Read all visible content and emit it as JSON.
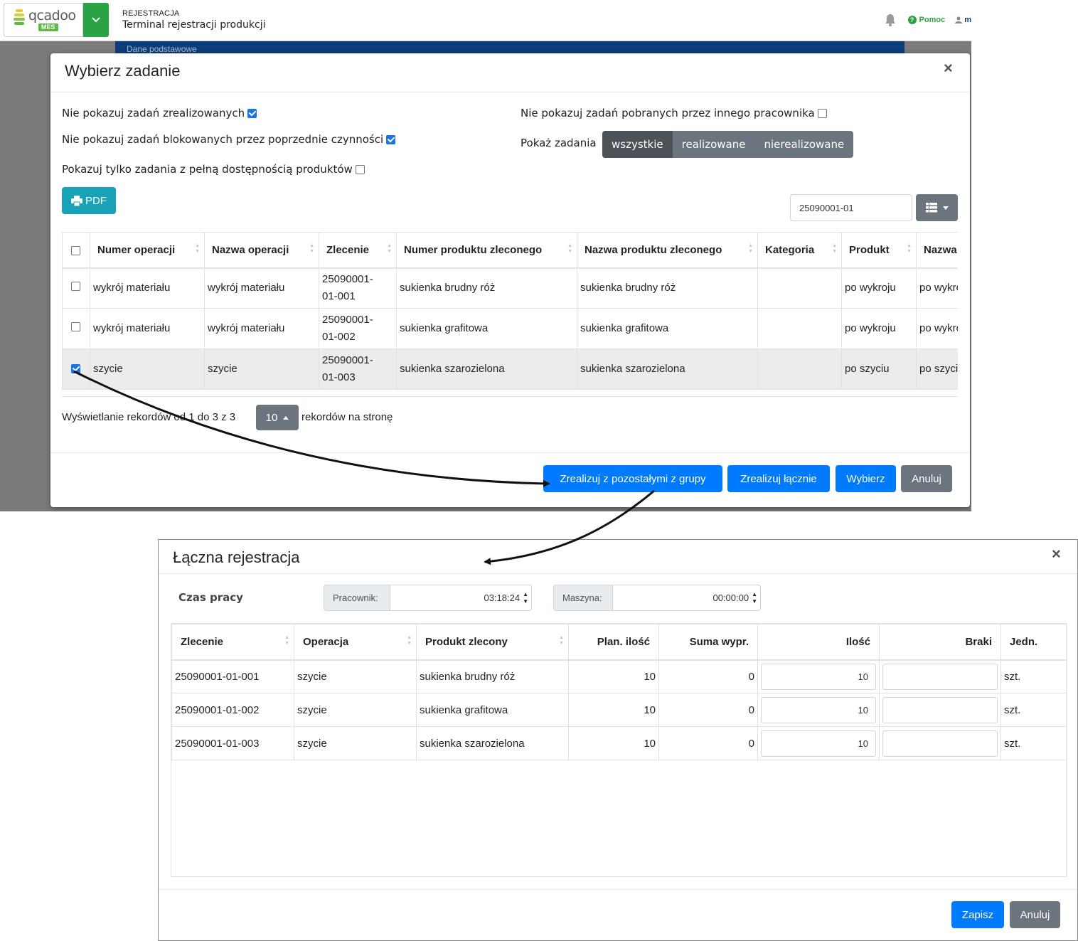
{
  "app": {
    "logo_text": "qcadoo",
    "logo_badge": "MES",
    "breadcrumb_small": "REJESTRACJA",
    "breadcrumb_title": "Terminal rejestracji produkcji",
    "help_label": "Pomoc",
    "help_icon_text": "?",
    "user_label": "m",
    "background_strip": "Dane podstawowe"
  },
  "colors": {
    "primary": "#007bff",
    "secondary": "#6c757d",
    "info": "#17a2b8",
    "brand_green": "#2aa345"
  },
  "select_task_modal": {
    "title": "Wybierz zadanie",
    "close": "×",
    "options": {
      "hide_completed": {
        "label": "Nie pokazuj zadań zrealizowanych",
        "checked": true
      },
      "hide_blocked": {
        "label": "Nie pokazuj zadań blokowanych przez poprzednie czynności",
        "checked": true
      },
      "only_full_availability": {
        "label": "Pokazuj tylko zadania z pełną dostępnością produktów",
        "checked": false
      },
      "hide_taken_by_other": {
        "label": "Nie pokazuj zadań pobranych przez innego pracownika",
        "checked": false
      }
    },
    "show_tasks_label": "Pokaż zadania",
    "show_tasks_options": [
      "wszystkie",
      "realizowane",
      "nierealizowane"
    ],
    "show_tasks_selected": "wszystkie",
    "pdf_label": "PDF",
    "search_value": "25090001-01",
    "columns": [
      "Numer operacji",
      "Nazwa operacji",
      "Zlecenie",
      "Numer produktu zleconego",
      "Nazwa produktu zleconego",
      "Kategoria",
      "Produkt",
      "Nazwa"
    ],
    "rows": [
      {
        "checked": false,
        "cells": [
          "wykrój materiału",
          "wykrój materiału",
          "25090001-01-001",
          "sukienka brudny róż",
          "sukienka brudny róż",
          "",
          "po wykroju",
          "po wykroju"
        ]
      },
      {
        "checked": false,
        "cells": [
          "wykrój materiału",
          "wykrój materiału",
          "25090001-01-002",
          "sukienka grafitowa",
          "sukienka grafitowa",
          "",
          "po wykroju",
          "po wykroju"
        ]
      },
      {
        "checked": true,
        "cells": [
          "szycie",
          "szycie",
          "25090001-01-003",
          "sukienka szarozielona",
          "sukienka szarozielona",
          "",
          "po szyciu",
          "po szyciu"
        ]
      }
    ],
    "pager_text": "Wyświetlanie rekordów od 1 do 3 z 3",
    "page_size": "10",
    "pager_suffix": "rekordów na stronę",
    "buttons": {
      "realize_group": "Zrealizuj z pozostałymi z grupy",
      "realize_together": "Zrealizuj łącznie",
      "choose": "Wybierz",
      "cancel": "Anuluj"
    }
  },
  "joint_registration_modal": {
    "title": "Łączna rejestracja",
    "close": "×",
    "work_time_label": "Czas pracy",
    "worker_label": "Pracownik:",
    "worker_value": "03:18:24",
    "machine_label": "Maszyna:",
    "machine_value": "00:00:00",
    "columns": [
      "Zlecenie",
      "Operacja",
      "Produkt zlecony",
      "Plan. ilość",
      "Suma wypr.",
      "Ilość",
      "Braki",
      "Jedn."
    ],
    "rows": [
      {
        "order": "25090001-01-001",
        "operation": "szycie",
        "product": "sukienka brudny róż",
        "planned": "10",
        "produced": "0",
        "quantity": "10",
        "waste": "",
        "unit": "szt."
      },
      {
        "order": "25090001-01-002",
        "operation": "szycie",
        "product": "sukienka grafitowa",
        "planned": "10",
        "produced": "0",
        "quantity": "10",
        "waste": "",
        "unit": "szt."
      },
      {
        "order": "25090001-01-003",
        "operation": "szycie",
        "product": "sukienka szarozielona",
        "planned": "10",
        "produced": "0",
        "quantity": "10",
        "waste": "",
        "unit": "szt."
      }
    ],
    "buttons": {
      "save": "Zapisz",
      "cancel": "Anuluj"
    }
  }
}
